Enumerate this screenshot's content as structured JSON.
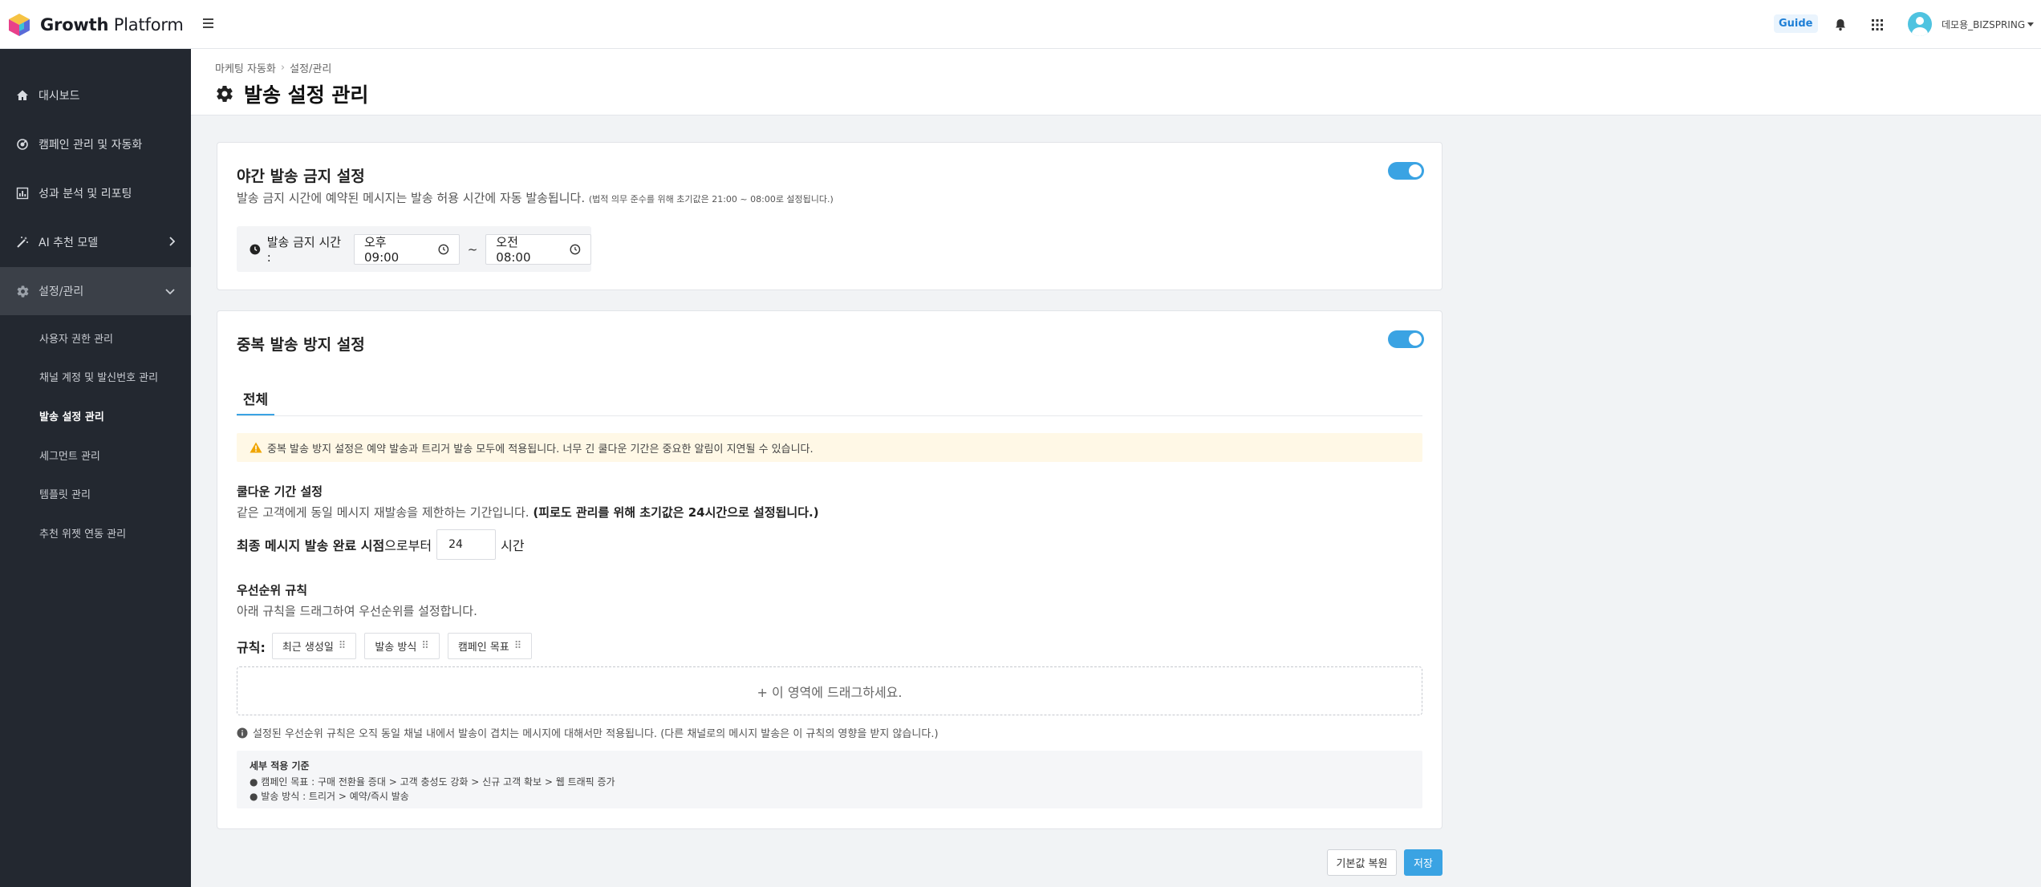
{
  "app": {
    "logo_bold": "Growth",
    "logo_light": " Platform",
    "guide_label": "Guide",
    "user_name": "데모용_BIZSPRING"
  },
  "sidebar": {
    "items": [
      {
        "label": "대시보드",
        "icon": "home-icon"
      },
      {
        "label": "캠페인 관리 및 자동화",
        "icon": "campaign-icon"
      },
      {
        "label": "성과 분석 및 리포팅",
        "icon": "chart-icon"
      },
      {
        "label": "AI 추천 모델",
        "icon": "magic-wand-icon"
      },
      {
        "label": "설정/관리",
        "icon": "gear-icon"
      }
    ],
    "sub_items": [
      "사용자 권한 관리",
      "채널 계정 및 발신번호 관리",
      "발송 설정 관리",
      "세그먼트 관리",
      "템플릿 관리",
      "추천 위젯 연동 관리"
    ]
  },
  "header": {
    "breadcrumb": [
      "마케팅 자동화",
      "설정/관리"
    ],
    "title": "발송 설정 관리"
  },
  "night": {
    "title": "야간 발송 금지 설정",
    "desc": "발송 금지 시간에 예약된 메시지는 발송 허용 시간에 자동 발송됩니다.",
    "desc_note": "(법적 의무 준수를 위해 초기값은 21:00 ~ 08:00로 설정됩니다.)",
    "time_label": "발송 금지 시간 :",
    "start": "오후 09:00",
    "tilde": "~",
    "end": "오전 08:00",
    "enabled": true
  },
  "dup": {
    "title": "중복 발송 방지 설정",
    "enabled": true,
    "tab": "전체",
    "warning": "중복 발송 방지 설정은 예약 발송과 트리거 발송 모두에 적용됩니다. 너무 긴 쿨다운 기간은 중요한 알림이 지연될 수 있습니다.",
    "cooldown_title": "쿨다운 기간 설정",
    "cooldown_desc": "같은 고객에게 동일 메시지 재발송을 제한하는 기간입니다.",
    "cooldown_note": "(피로도 관리를 위해 초기값은 24시간으로 설정됩니다.)",
    "cooldown_prefix_bold": "최종 메시지 발송 완료 시점",
    "cooldown_prefix": "으로부터",
    "cooldown_value": "24",
    "cooldown_unit": "시간",
    "priority_title": "우선순위 규칙",
    "priority_desc": "아래 규칙을 드래그하여 우선순위를 설정합니다.",
    "rules_label": "규칙:",
    "rules": [
      "최근 생성일",
      "발송 방식",
      "캠페인 목표"
    ],
    "rule_grip": "⠿",
    "dropzone": "+ 이 영역에 드래그하세요.",
    "info": "설정된 우선순위 규칙은 오직 동일 채널 내에서 발송이 겹치는 메시지에 대해서만 적용됩니다. (다른 채널로의 메시지 발송은 이 규칙의 영향을 받지 않습니다.)",
    "criteria_title": "세부 적용 기준",
    "criteria": [
      "● 캠페인 목표 : 구매 전환율 증대 > 고객 충성도 강화 > 신규 고객 확보 > 웹 트래픽 증가",
      "● 발송 방식 : 트리거 > 예약/즉시 발송"
    ]
  },
  "footer": {
    "reset_label": "기본값 복원",
    "save_label": "저장"
  },
  "colors": {
    "accent": "#3aa3e3",
    "sidebar_bg": "#232830",
    "warning_bg": "#fff8e6"
  }
}
